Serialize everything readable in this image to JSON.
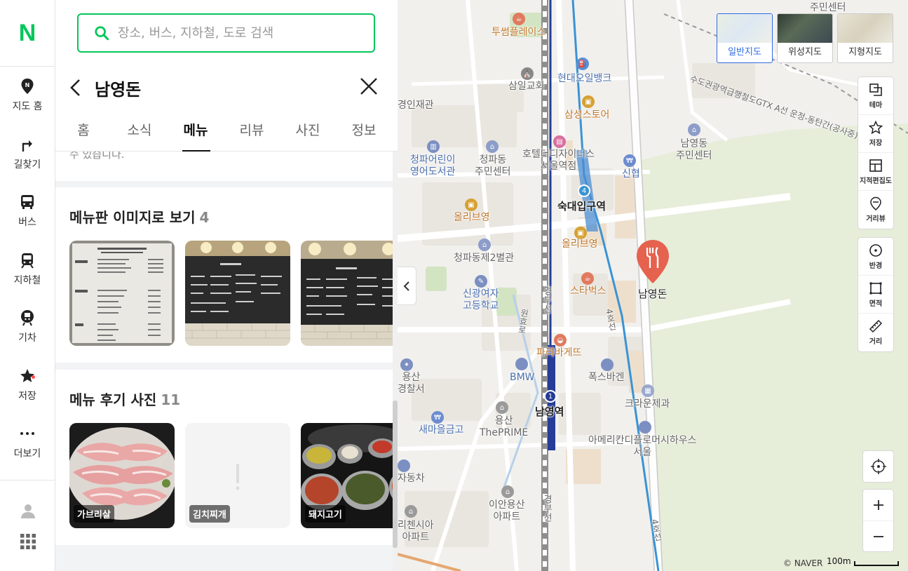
{
  "rail": {
    "logo": "N",
    "items": [
      {
        "label": "지도 홈",
        "icon": "map-pin-icon"
      },
      {
        "label": "길찾기",
        "icon": "directions-icon"
      },
      {
        "label": "버스",
        "icon": "bus-icon"
      },
      {
        "label": "지하철",
        "icon": "subway-icon"
      },
      {
        "label": "기차",
        "icon": "train-icon"
      },
      {
        "label": "저장",
        "icon": "star-icon"
      },
      {
        "label": "더보기",
        "icon": "more-icon"
      }
    ]
  },
  "search": {
    "placeholder": "장소, 버스, 지하철, 도로 검색"
  },
  "place": {
    "title": "남영돈"
  },
  "tabs": [
    {
      "label": "홈"
    },
    {
      "label": "소식"
    },
    {
      "label": "메뉴",
      "active": true
    },
    {
      "label": "리뷰"
    },
    {
      "label": "사진"
    },
    {
      "label": "정보"
    }
  ],
  "content": {
    "cut_text": "수 있습니다.",
    "menu_board": {
      "title": "메뉴판 이미지로 보기",
      "count": "4"
    },
    "menu_reviews": {
      "title": "메뉴 후기 사진",
      "count": "11",
      "items": [
        {
          "tag": "가브리살"
        },
        {
          "tag": "김치찌개"
        },
        {
          "tag": "돼지고기"
        }
      ]
    }
  },
  "map": {
    "types": [
      {
        "label": "일반지도",
        "active": true
      },
      {
        "label": "위성지도"
      },
      {
        "label": "지형지도"
      }
    ],
    "tools": [
      {
        "label": "테마"
      },
      {
        "label": "저장"
      },
      {
        "label": "지적편집도"
      },
      {
        "label": "거리뷰"
      }
    ],
    "tools2": [
      {
        "label": "반경"
      },
      {
        "label": "면적"
      },
      {
        "label": "거리"
      }
    ],
    "labels": {
      "twosome": "투썸플레이스",
      "juminsenter": "주민센터",
      "samil": "삼일교회",
      "hyundai": "현대오일뱅크",
      "samsung": "삼성스토어",
      "hotel": "호텔더디자이너스",
      "hotel2": "서울역점",
      "gyeongin": "경인재관",
      "library": "청파어린이",
      "library2": "영어도서관",
      "cheongpa": "청파동",
      "cheongpa2": "주민센터",
      "shinhyup": "신협",
      "namyoung_center": "남영동",
      "namyoung_center2": "주민센터",
      "sookdae": "숙대입구역",
      "olive1": "올리브영",
      "olive2": "올리브영",
      "annex": "청파동제2별관",
      "shingwang": "신광여자",
      "shingwang2": "고등학교",
      "starbucks": "스타벅스",
      "restaurant": "남영돈",
      "paris": "파리바게뜨",
      "bmw": "BMW",
      "volkswagen": "폭스바겐",
      "namyoung_station": "남영역",
      "crown": "크라운제과",
      "saemaeul": "새마을금고",
      "yongsan": "용산",
      "prime": "ThePRIME",
      "american": "아메리칸디플로머시하우스",
      "american2": "서울",
      "wonhyo": "원효로",
      "police": "용산",
      "police2": "경찰서",
      "motor": "자동차",
      "richensia": "리첸시아",
      "richensia2": "아파트",
      "ian": "이안용산",
      "ian2": "아파트",
      "gtx": "수도권광역급행철도GTX A선 운정-동탄간(공사중)",
      "line4a": "4호선",
      "line4b": "4호선",
      "gyeongbu1": "경부선",
      "gyeongbu2": "경부선",
      "station_4": "4",
      "station_1": "1"
    },
    "copyright": "© NAVER",
    "scale": "100m"
  },
  "colors": {
    "brand": "#03c75a",
    "restaurant_pin": "#e5624f",
    "line1": "#263c96",
    "line4": "#3a93d4"
  }
}
